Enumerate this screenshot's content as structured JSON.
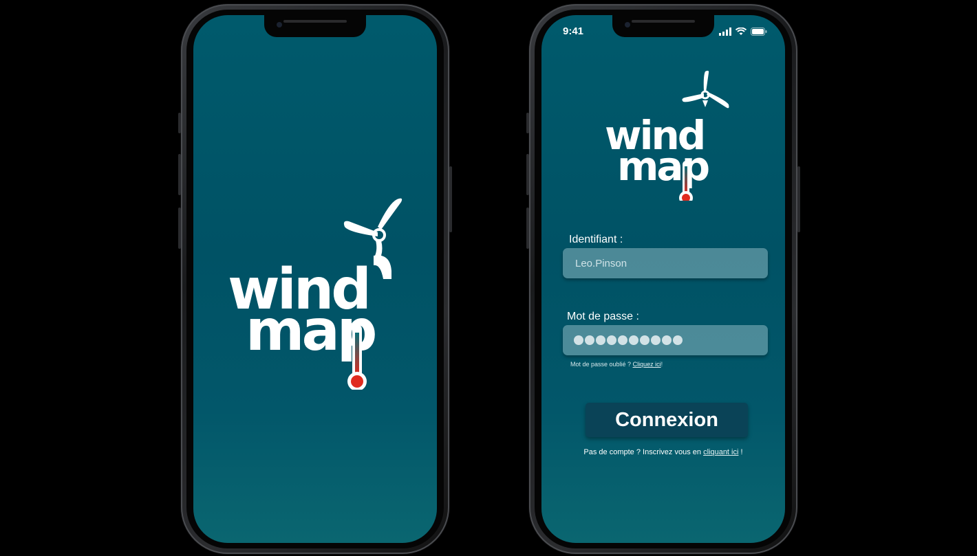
{
  "colors": {
    "screen_bg": "#005a6c",
    "button_bg": "#0a4357",
    "thermo_red": "#e02b1f",
    "text": "#ffffff"
  },
  "splash_screen": {
    "logo": {
      "line1": "wind",
      "line2": "map"
    }
  },
  "login_screen": {
    "status_bar": {
      "time": "9:41",
      "icons": [
        "signal-icon",
        "wifi-icon",
        "battery-icon"
      ]
    },
    "logo": {
      "line1": "wind",
      "line2": "map"
    },
    "username": {
      "label": "Identifiant :",
      "value": "Leo.Pinson"
    },
    "password": {
      "label": "Mot de passe :",
      "masked_length": 10
    },
    "forgot_password": {
      "text": "Mot de passe oublié ?",
      "link": "Cliquez ici",
      "suffix": "!"
    },
    "connect_button": "Connexion",
    "signup": {
      "text": "Pas de compte ? Inscrivez vous en",
      "link": "cliquant ici",
      "suffix": "!"
    }
  }
}
